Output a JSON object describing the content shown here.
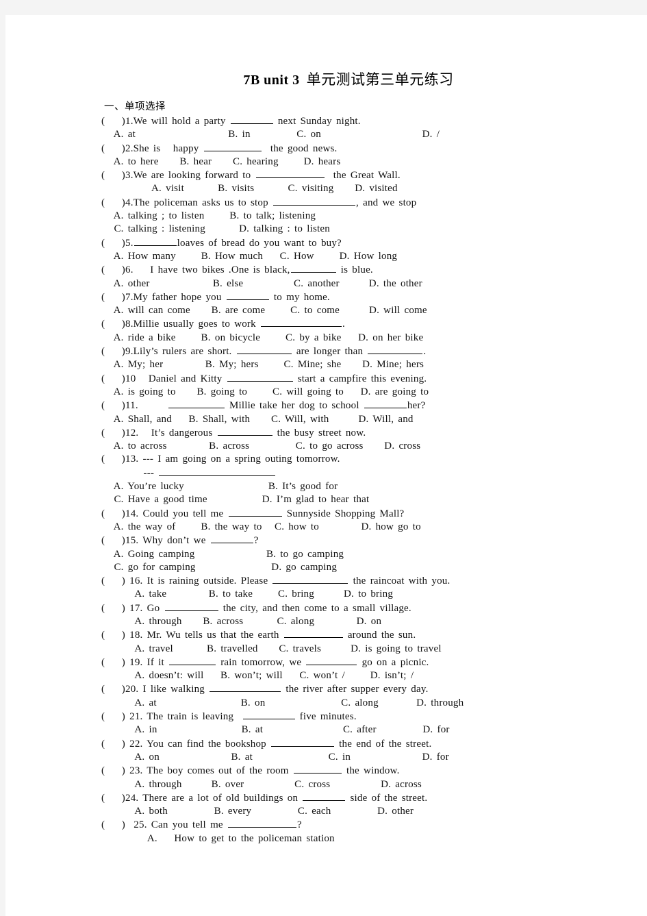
{
  "document": {
    "title_en": "7B unit 3",
    "title_cn": "单元测试第三单元练习",
    "section_heading": "一、单项选择"
  },
  "questions": [
    {
      "marker": "(    )1.",
      "stem_before": "We will hold a party ",
      "blank_width": 62,
      "stem_after": " next Sunday night.",
      "option_lines": [
        "   A. at                      B. in           C. on                        D. /"
      ]
    },
    {
      "marker": "(    )2.",
      "stem_before": "She is   happy ",
      "blank_width": 84,
      "stem_after": "  the good news.",
      "option_lines": [
        "   A. to here     B. hear     C. hearing      D. hears"
      ]
    },
    {
      "marker": "(    )3.",
      "stem_before": "We are looking forward to ",
      "blank_width": 100,
      "stem_after": "  the Great Wall.",
      "option_lines": [
        "            A. visit        B. visits        C. visiting     D. visited"
      ]
    },
    {
      "marker": "(    )4.",
      "stem_before": "The policeman asks us to stop ",
      "blank_width": 120,
      "stem_after": ", and we stop",
      "option_lines": [
        "   A. talking ; to listen      B. to talk; listening",
        "   C. talking : listening        D. talking : to listen"
      ]
    },
    {
      "marker": "(    )5.",
      "stem_before": "",
      "blank_width": 62,
      "stem_after": "loaves of bread do you want to buy?",
      "option_lines": [
        "   A. How many      B. How much    C. How      D. How long"
      ]
    },
    {
      "marker": "(    )6.",
      "stem_before": "    I have two bikes .One is black,",
      "blank_width": 66,
      "stem_after": " is blue.",
      "option_lines": [
        "   A. other               B. else            C. another       D. the other"
      ]
    },
    {
      "marker": "(    )7.",
      "stem_before": "My father hope you ",
      "blank_width": 62,
      "stem_after": " to my home.",
      "option_lines": [
        "   A. will can come     B. are come      C. to come       D. will come"
      ]
    },
    {
      "marker": "(    )8.",
      "stem_before": "Millie usually goes to work ",
      "blank_width": 118,
      "stem_after": ".",
      "option_lines": [
        "   A. ride a bike      B. on bicycle      C. by a bike    D. on her bike"
      ]
    },
    {
      "marker": "(    )9.",
      "stem_before": "Lily’s rulers are short. ",
      "blank_width": 80,
      "stem_after": " are longer than ",
      "blank2_width": 80,
      "stem_end": ".",
      "option_lines": [
        "   A. My; her          B. My; hers      C. Mine; she     D. Mine; hers"
      ]
    },
    {
      "marker": "(    )10",
      "stem_before": "   Daniel and Kitty ",
      "blank_width": 96,
      "stem_after": " start a campfire this evening.",
      "option_lines": [
        "   A. is going to     B. going to      C. will going to    D. are going to"
      ]
    },
    {
      "marker": "(    )11.",
      "stem_before": "       ",
      "blank_width": 82,
      "stem_after": " Millie take her dog to school ",
      "blank2_width": 62,
      "stem_end": "her?",
      "option_lines": [
        "   A. Shall, and    B. Shall, with     C. Will, with       D. Will, and"
      ]
    },
    {
      "marker": "(    )12.",
      "stem_before": "   It’s dangerous ",
      "blank_width": 80,
      "stem_after": " the busy street now.",
      "option_lines": [
        "   A. to across          B. across           C. to go across     D. cross"
      ]
    },
    {
      "marker": "(    )13.",
      "stem_before": " --- I am going on a spring outing tomorrow.",
      "blank_width": 0,
      "stem_after": "",
      "extra_line_prefix": "          --- ",
      "extra_blank_width": 170,
      "option_lines": [
        "   A. You’re lucky                    B. It’s good for",
        "   C. Have a good time             D. I’m glad to hear that"
      ]
    },
    {
      "marker": "(    )14.",
      "stem_before": " Could you tell me ",
      "blank_width": 78,
      "stem_after": " Sunnyside Shopping Mall?",
      "option_lines": [
        "   A. the way of      B. the way to   C. how to          D. how go to"
      ]
    },
    {
      "marker": "(    )15.",
      "stem_before": " Why don’t we ",
      "blank_width": 62,
      "stem_after": "?",
      "option_lines": [
        "   A. Going camping                 B. to go camping",
        "   C. go for camping                  D. go camping"
      ]
    },
    {
      "marker": "(    ) 16.",
      "stem_before": " It is raining outside. Please ",
      "blank_width": 110,
      "stem_after": " the raincoat with you.",
      "option_lines": [
        "        A. take          B. to take      C. bring       D. to bring"
      ]
    },
    {
      "marker": "(    ) 17.",
      "stem_before": " Go ",
      "blank_width": 78,
      "stem_after": " the city, and then come to a small village.",
      "option_lines": [
        "        A. through     B. across        C. along          D. on"
      ]
    },
    {
      "marker": "(    ) 18.",
      "stem_before": " Mr. Wu tells us that the earth ",
      "blank_width": 86,
      "stem_after": " around the sun.",
      "option_lines": [
        "        A. travel        B. travelled     C. travels       D. is going to travel"
      ]
    },
    {
      "marker": "(    ) 19.",
      "stem_before": " If it ",
      "blank_width": 68,
      "stem_after": " rain tomorrow, we ",
      "blank2_width": 74,
      "stem_end": " go on a picnic.",
      "option_lines": [
        "        A. doesn’t: will    B. won’t; will    C. won’t /      D. isn’t; /"
      ]
    },
    {
      "marker": "(    )20.",
      "stem_before": " I like walking ",
      "blank_width": 104,
      "stem_after": " the river after supper every day.",
      "option_lines": [
        "        A. at                    B. on                  C. along         D. through"
      ]
    },
    {
      "marker": "(    ) 21.",
      "stem_before": " The train is leaving  ",
      "blank_width": 76,
      "stem_after": " five minutes.",
      "option_lines": [
        "        A. in                    B. at                   C. after           D. for"
      ]
    },
    {
      "marker": "(    ) 22.",
      "stem_before": " You can find the bookshop ",
      "blank_width": 92,
      "stem_after": " the end of the street.",
      "option_lines": [
        "        A. on                 B. at                  C. in                 D. for"
      ]
    },
    {
      "marker": "(    ) 23.",
      "stem_before": " The boy comes out of the room ",
      "blank_width": 70,
      "stem_after": " the window.",
      "option_lines": [
        "        A. through       B. over            C. cross            D. across"
      ]
    },
    {
      "marker": "(    )24.",
      "stem_before": " There are a lot of old buildings on ",
      "blank_width": 62,
      "stem_after": " side of the street.",
      "option_lines": [
        "        A. both           B. every           C. each           D. other"
      ]
    },
    {
      "marker": "(    )  25.",
      "stem_before": " Can you tell me ",
      "blank_width": 100,
      "stem_after": "?",
      "option_lines": [
        "           A.    How to get to the policeman station"
      ]
    }
  ]
}
